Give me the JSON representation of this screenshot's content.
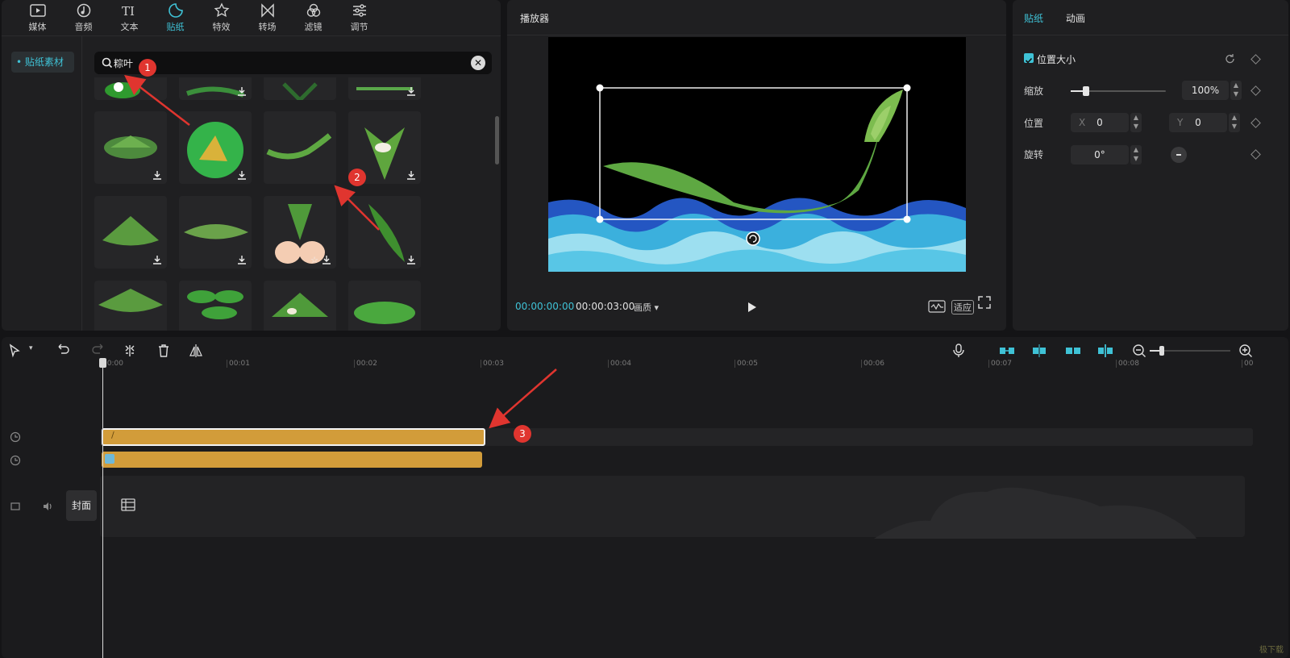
{
  "toolbar": {
    "tabs": [
      {
        "label": "媒体",
        "icon": "media-icon"
      },
      {
        "label": "音频",
        "icon": "audio-icon"
      },
      {
        "label": "文本",
        "icon": "text-icon"
      },
      {
        "label": "贴纸",
        "icon": "sticker-icon",
        "active": true
      },
      {
        "label": "特效",
        "icon": "effects-icon"
      },
      {
        "label": "转场",
        "icon": "transition-icon"
      },
      {
        "label": "滤镜",
        "icon": "filter-icon"
      },
      {
        "label": "调节",
        "icon": "adjust-icon"
      }
    ]
  },
  "sidebar": {
    "items": [
      {
        "label": "• 贴纸素材"
      }
    ]
  },
  "search": {
    "value": "粽叶"
  },
  "player": {
    "title": "播放器",
    "current_time": "00:00:00:00",
    "total_time": "00:00:03:00",
    "ratio_label": "画质",
    "fit_label": "适应"
  },
  "inspector": {
    "tabs": [
      "贴纸",
      "动画"
    ],
    "section_title": "位置大小",
    "scale_label": "缩放",
    "scale_value": "100%",
    "scale_fraction": 0.16,
    "position_label": "位置",
    "x_label": "X",
    "x_value": "0",
    "y_label": "Y",
    "y_value": "0",
    "rotation_label": "旋转",
    "rotation_value": "0°"
  },
  "timeline": {
    "ruler_labels": [
      "00:00",
      "00:01",
      "00:02",
      "00:03",
      "00:04",
      "00:05",
      "00:06",
      "00:07",
      "00:08",
      "00"
    ],
    "cover_label": "封面"
  },
  "annotations": [
    "1",
    "2",
    "3"
  ],
  "colors": {
    "accent": "#3fc2d6",
    "clip": "#d29c3a",
    "badge": "#e0352f"
  },
  "watermark": "极下载"
}
